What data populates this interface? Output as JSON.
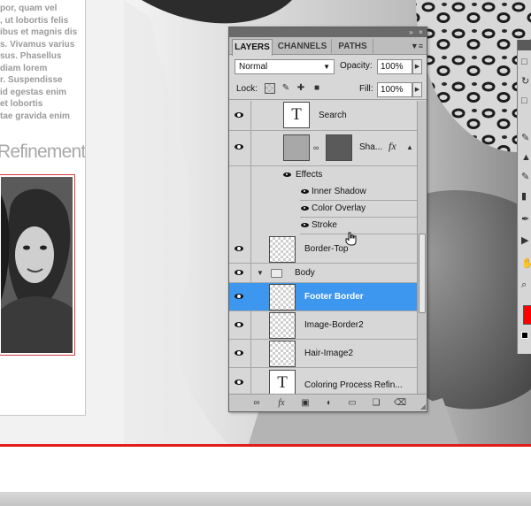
{
  "document": {
    "body_lines": [
      "por, quam vel",
      ", ut lobortis felis",
      "ibus et magnis dis",
      "s. Vivamus varius",
      "sus. Phasellus",
      "diam lorem",
      "r. Suspendisse",
      "id egestas enim",
      "et lobortis",
      "tae gravida enim"
    ],
    "section_heading": "Refinement"
  },
  "layers_panel": {
    "tabs": [
      {
        "label": "LAYERS",
        "active": true
      },
      {
        "label": "CHANNELS",
        "active": false
      },
      {
        "label": "PATHS",
        "active": false
      }
    ],
    "blend_mode": "Normal",
    "opacity_label": "Opacity:",
    "opacity_value": "100%",
    "lock_label": "Lock:",
    "fill_label": "Fill:",
    "fill_value": "100%",
    "layers": [
      {
        "name": "Search",
        "kind": "text"
      },
      {
        "name": "Sha...",
        "kind": "shape",
        "has_fx": true
      },
      {
        "name": "Effects",
        "kind": "effects-header"
      },
      {
        "name": "Inner Shadow",
        "kind": "effect"
      },
      {
        "name": "Color Overlay",
        "kind": "effect"
      },
      {
        "name": "Stroke",
        "kind": "effect"
      },
      {
        "name": "Border-Top",
        "kind": "pixel"
      },
      {
        "name": "Body",
        "kind": "group"
      },
      {
        "name": "Footer Border",
        "kind": "pixel",
        "selected": true
      },
      {
        "name": "Image-Border2",
        "kind": "pixel"
      },
      {
        "name": "Hair-Image2",
        "kind": "pixel"
      },
      {
        "name": "Coloring Process Refin...",
        "kind": "text"
      }
    ],
    "fx_symbol": "fx",
    "text_thumb_glyph": "T"
  },
  "colors": {
    "selection": "#3d97ee",
    "foreground": "#ff0000",
    "rule": "#e21c1c"
  }
}
